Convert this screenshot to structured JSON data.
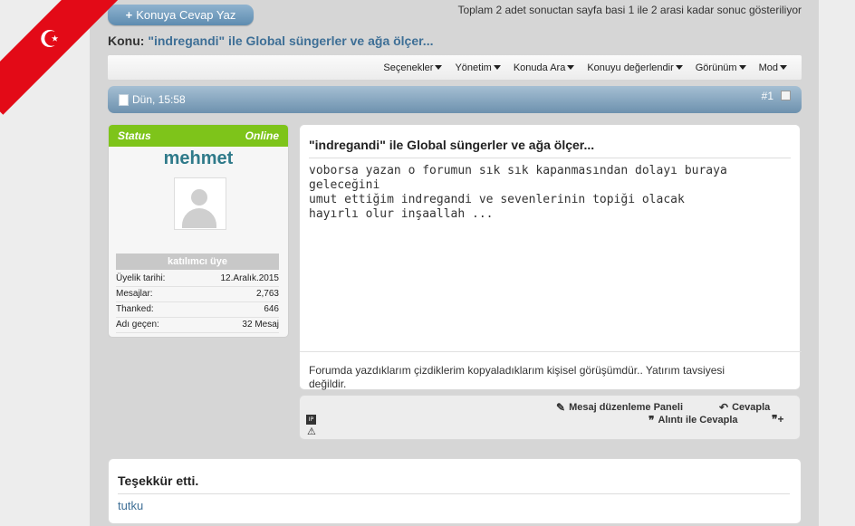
{
  "header": {
    "reply_button_label": "Konuya Cevap Yaz",
    "page_info": "Toplam 2 adet sonuctan sayfa basi 1 ile 2 arasi kadar sonuc gösteriliyor",
    "thread_prefix": "Konu:",
    "thread_title": "\"indregandi\" ile Global süngerler ve ağa ölçer..."
  },
  "toolbar": {
    "items": [
      "Seçenekler",
      "Yönetim",
      "Konuda Ara",
      "Konuyu değerlendir",
      "Görünüm",
      "Mod"
    ]
  },
  "post": {
    "date": "Dün, 15:58",
    "number": "#1",
    "title": "\"indregandi\" ile Global süngerler ve ağa ölçer...",
    "body": "voborsa yazan o forumun sık sık kapanmasından dolayı buraya geleceğini\numut ettiğim indregandi ve sevenlerinin topiği olacak\nhayırlı olur inşaallah ...",
    "signature": "Forumda yazdıklarım çizdiklerim kopyaladıklarım kişisel görüşümdür.. Yatırım tavsiyesi değildir."
  },
  "user": {
    "status_label": "Status",
    "status_value": "Online",
    "name": "mehmet",
    "rank": "katılımcı üye",
    "stats": [
      {
        "label": "Üyelik tarihi:",
        "value": "12.Aralık.2015"
      },
      {
        "label": "Mesajlar:",
        "value": "2,763"
      },
      {
        "label": "Thanked:",
        "value": "646"
      },
      {
        "label": "Adı geçen:",
        "value": "32 Mesaj"
      }
    ]
  },
  "actions": {
    "edit_panel": "Mesaj düzenleme Paneli",
    "reply": "Cevapla",
    "quote_reply": "Alıntı ile Cevapla",
    "ip_label": "IP"
  },
  "thanks": {
    "title": "Teşekkür etti.",
    "user": "tutku"
  },
  "colors": {
    "status_green": "#7ec41a",
    "username": "#2f7a8a",
    "link_blue": "#3e6f96",
    "flag_red": "#e30a17"
  }
}
